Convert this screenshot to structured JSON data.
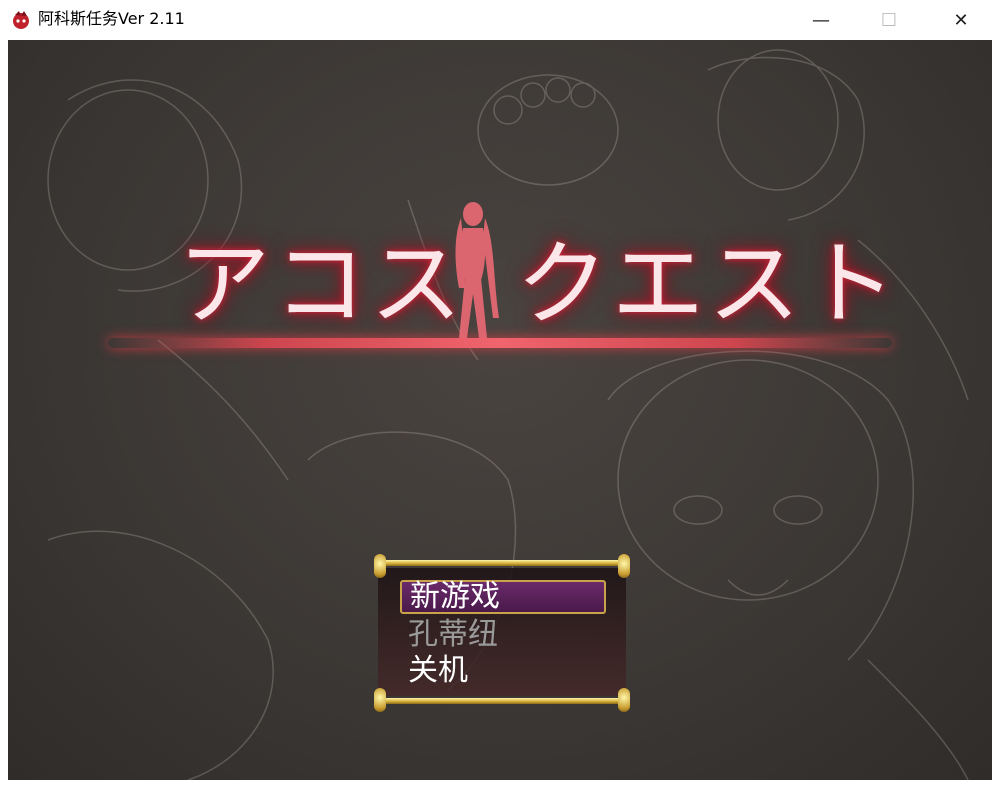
{
  "window": {
    "title": "阿科斯任务Ver 2.11",
    "minimize_glyph": "—",
    "maximize_glyph": "☐",
    "close_glyph": "✕"
  },
  "game": {
    "title_left": "アコス",
    "title_right": "クエスト",
    "accent_color": "#e0414f",
    "menu": {
      "selected_index": 0,
      "items": [
        {
          "label": "新游戏",
          "enabled": true
        },
        {
          "label": "孔蒂纽",
          "enabled": false
        },
        {
          "label": "关机",
          "enabled": true
        }
      ]
    }
  },
  "icons": {
    "app": "game-app-icon",
    "silhouette": "character-silhouette"
  }
}
